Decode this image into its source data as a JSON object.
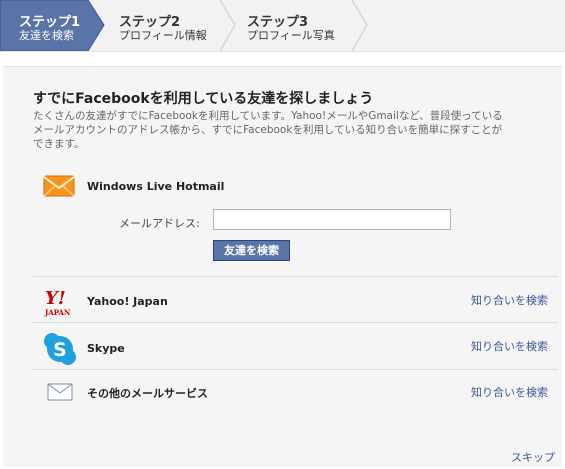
{
  "steps": [
    {
      "title": "ステップ1",
      "subtitle": "友達を検索",
      "active": true
    },
    {
      "title": "ステップ2",
      "subtitle": "プロフィール情報",
      "active": false
    },
    {
      "title": "ステップ3",
      "subtitle": "プロフィール写真",
      "active": false
    }
  ],
  "main": {
    "heading": "すでにFacebookを利用している友達を探しましょう",
    "description": "たくさんの友達がすでにFacebookを利用しています。Yahoo!メールやGmailなど、普段使っているメールアカウントのアドレス帳から、すでにFacebookを利用している知り合いを簡単に探すことができます。",
    "hotmail": {
      "name": "Windows Live Hotmail",
      "email_label": "メールアドレス:",
      "email_value": "",
      "email_placeholder": "",
      "find_button": "友達を検索"
    },
    "services": [
      {
        "name": "Yahoo! Japan",
        "icon": "yahoo-japan-logo",
        "link": "知り合いを検索"
      },
      {
        "name": "Skype",
        "icon": "skype-icon",
        "link": "知り合いを検索"
      },
      {
        "name": "その他のメールサービス",
        "icon": "envelope-icon",
        "link": "知り合いを検索"
      }
    ],
    "skip": "スキップ"
  },
  "colors": {
    "active_step": "#5b74a8",
    "link": "#3b5998",
    "hotmail_orange": "#f7941d",
    "skype_blue": "#1ea1dd",
    "yahoo_red": "#cc0000"
  }
}
